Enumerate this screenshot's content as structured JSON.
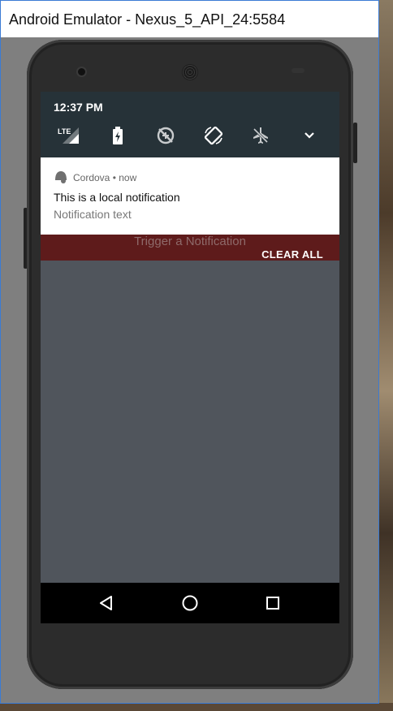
{
  "window": {
    "title": "Android Emulator - Nexus_5_API_24:5584"
  },
  "status": {
    "time": "12:37 PM"
  },
  "quick_settings": [
    {
      "icon": "lte-signal-icon",
      "label": "LTE"
    },
    {
      "icon": "battery-charging-icon"
    },
    {
      "icon": "data-saver-off-icon"
    },
    {
      "icon": "auto-rotate-icon"
    },
    {
      "icon": "airplane-mode-icon"
    },
    {
      "icon": "expand-chevron-icon"
    }
  ],
  "notification": {
    "app_name": "Cordova",
    "separator": "•",
    "time": "now",
    "title": "This is a local notification",
    "text": "Notification text"
  },
  "app": {
    "trigger_label": "Trigger a Notification"
  },
  "shade": {
    "clear_all_label": "CLEAR ALL"
  },
  "navigation": [
    {
      "icon": "back-icon"
    },
    {
      "icon": "home-icon"
    },
    {
      "icon": "recents-icon"
    }
  ]
}
